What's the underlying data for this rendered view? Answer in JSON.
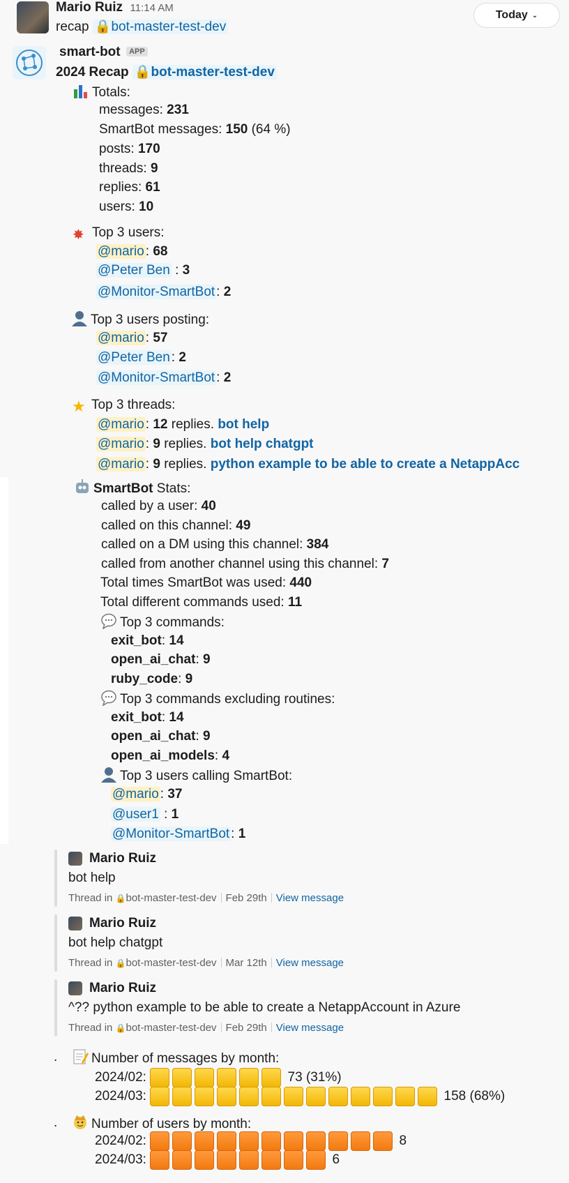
{
  "header_msg": {
    "author": "Mario Ruiz",
    "time": "11:14 AM",
    "text": "recap",
    "channel": "bot-master-test-dev"
  },
  "today_button": {
    "label": "Today"
  },
  "bot_msg": {
    "author": "smart-bot",
    "badge": "APP",
    "title": "2024 Recap",
    "channel": "bot-master-test-dev"
  },
  "totals": {
    "heading": "Totals:",
    "messages_label": "messages: ",
    "messages": "231",
    "smartbot_label": "SmartBot messages: ",
    "smartbot": "150",
    "smartbot_pct": " (64 %)",
    "posts_label": "posts: ",
    "posts": "170",
    "threads_label": "threads: ",
    "threads": "9",
    "replies_label": "replies: ",
    "replies": "61",
    "users_label": "users: ",
    "users": "10"
  },
  "top_users": {
    "heading": "Top 3 users:",
    "items": [
      {
        "mention": "@mario",
        "value": "68"
      },
      {
        "mention": "@Peter Ben",
        "value": "3"
      },
      {
        "mention": "@Monitor-SmartBot",
        "value": "2"
      }
    ]
  },
  "top_posting": {
    "heading": "Top 3 users posting:",
    "items": [
      {
        "mention": "@mario",
        "value": "57"
      },
      {
        "mention": "@Peter Ben",
        "value": "2"
      },
      {
        "mention": "@Monitor-SmartBot",
        "value": "2"
      }
    ]
  },
  "top_threads": {
    "heading": "Top 3 threads:",
    "items": [
      {
        "mention": "@mario",
        "count": "12",
        "mid": " replies. ",
        "link": "bot help"
      },
      {
        "mention": "@mario",
        "count": "9",
        "mid": " replies. ",
        "link": "bot help chatgpt"
      },
      {
        "mention": "@mario",
        "count": "9",
        "mid": " replies. ",
        "link": "python example to be able to create a NetappAcc"
      }
    ]
  },
  "smartbot_stats": {
    "heading_bold": "SmartBot",
    "heading_rest": " Stats:",
    "called_user_label": "called by a user: ",
    "called_user": "40",
    "called_channel_label": "called on this channel: ",
    "called_channel": "49",
    "called_dm_label": "called on a DM using this channel: ",
    "called_dm": "384",
    "called_other_label": "called from another channel using this channel: ",
    "called_other": "7",
    "total_used_label": "Total times SmartBot was used: ",
    "total_used": "440",
    "total_cmds_label": "Total different commands used: ",
    "total_cmds": "11",
    "top_cmds_heading": "Top 3 commands:",
    "top_cmds": [
      {
        "name": "exit_bot",
        "value": "14"
      },
      {
        "name": "open_ai_chat",
        "value": "9"
      },
      {
        "name": "ruby_code",
        "value": "9"
      }
    ],
    "top_cmds_ex_heading": "Top 3 commands excluding routines:",
    "top_cmds_ex": [
      {
        "name": "exit_bot",
        "value": "14"
      },
      {
        "name": "open_ai_chat",
        "value": "9"
      },
      {
        "name": "open_ai_models",
        "value": "4"
      }
    ],
    "top_callers_heading": "Top 3 users calling SmartBot:",
    "top_callers": [
      {
        "mention": "@mario",
        "value": "37"
      },
      {
        "mention": "@user1",
        "value": "1"
      },
      {
        "mention": "@Monitor-SmartBot",
        "value": "1"
      }
    ]
  },
  "thread_quotes": [
    {
      "author": "Mario Ruiz",
      "text": "bot help",
      "thread_in": "Thread in",
      "channel": "bot-master-test-dev",
      "date": "Feb 29th",
      "view": "View message"
    },
    {
      "author": "Mario Ruiz",
      "text": "bot help chatgpt",
      "thread_in": "Thread in",
      "channel": "bot-master-test-dev",
      "date": "Mar 12th",
      "view": "View message"
    },
    {
      "author": "Mario Ruiz",
      "text": "^?? python example to be able to create a NetappAccount in Azure",
      "thread_in": "Thread in",
      "channel": "bot-master-test-dev",
      "date": "Feb 29th",
      "view": "View message"
    }
  ],
  "msgs_by_month": {
    "dot": ".",
    "heading": "Number of messages by month:",
    "rows": [
      {
        "month": "2024/02:",
        "blocks": 6,
        "label": "73 (31%)"
      },
      {
        "month": "2024/03:",
        "blocks": 13,
        "label": "158 (68%)"
      }
    ]
  },
  "users_by_month": {
    "dot": ".",
    "heading": "Number of users by month:",
    "rows": [
      {
        "month": "2024/02:",
        "blocks": 11,
        "label": "8"
      },
      {
        "month": "2024/03:",
        "blocks": 8,
        "label": "6"
      }
    ]
  },
  "colors": {
    "link": "#1264a3",
    "mention_bg": "#e8f5fa",
    "self_mention_bg": "#fdf1c6",
    "bar_yellow": "#f5c400",
    "bar_orange": "#f7851f"
  }
}
